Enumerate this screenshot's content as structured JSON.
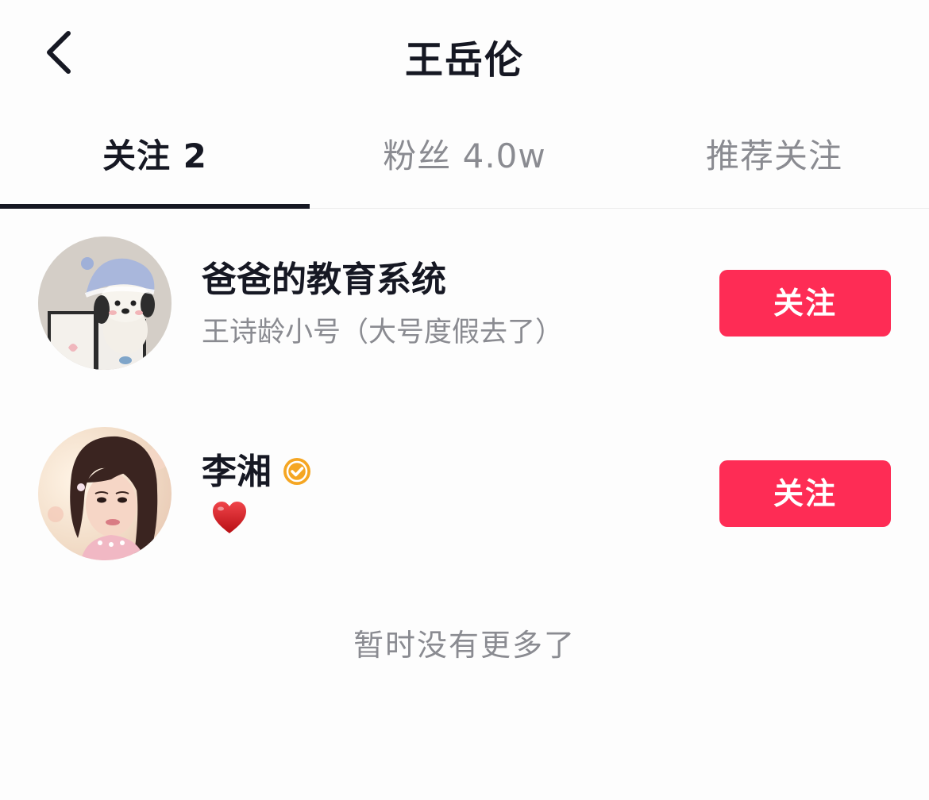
{
  "header": {
    "title": "王岳伦",
    "back_icon": "chevron-left-icon"
  },
  "tabs": [
    {
      "label": "关注 2",
      "active": true
    },
    {
      "label": "粉丝 4.0w",
      "active": false
    },
    {
      "label": "推荐关注",
      "active": false
    }
  ],
  "users": [
    {
      "name": "爸爸的教育系统",
      "subtitle": "王诗龄小号（大号度假去了）",
      "avatar_icon": "plush-dog-avatar",
      "verified": false,
      "button_label": "关注"
    },
    {
      "name": "李湘",
      "subtitle": "",
      "avatar_icon": "portrait-avatar",
      "verified": true,
      "verified_icon": "verified-badge-icon",
      "status_icon": "red-heart-icon",
      "button_label": "关注"
    }
  ],
  "footer": {
    "end_text": "暂时没有更多了"
  },
  "colors": {
    "accent": "#fe2c55",
    "verified": "#f5a623",
    "heart": "#d7191f",
    "text_primary": "#161823",
    "text_secondary": "#8a8b91"
  }
}
